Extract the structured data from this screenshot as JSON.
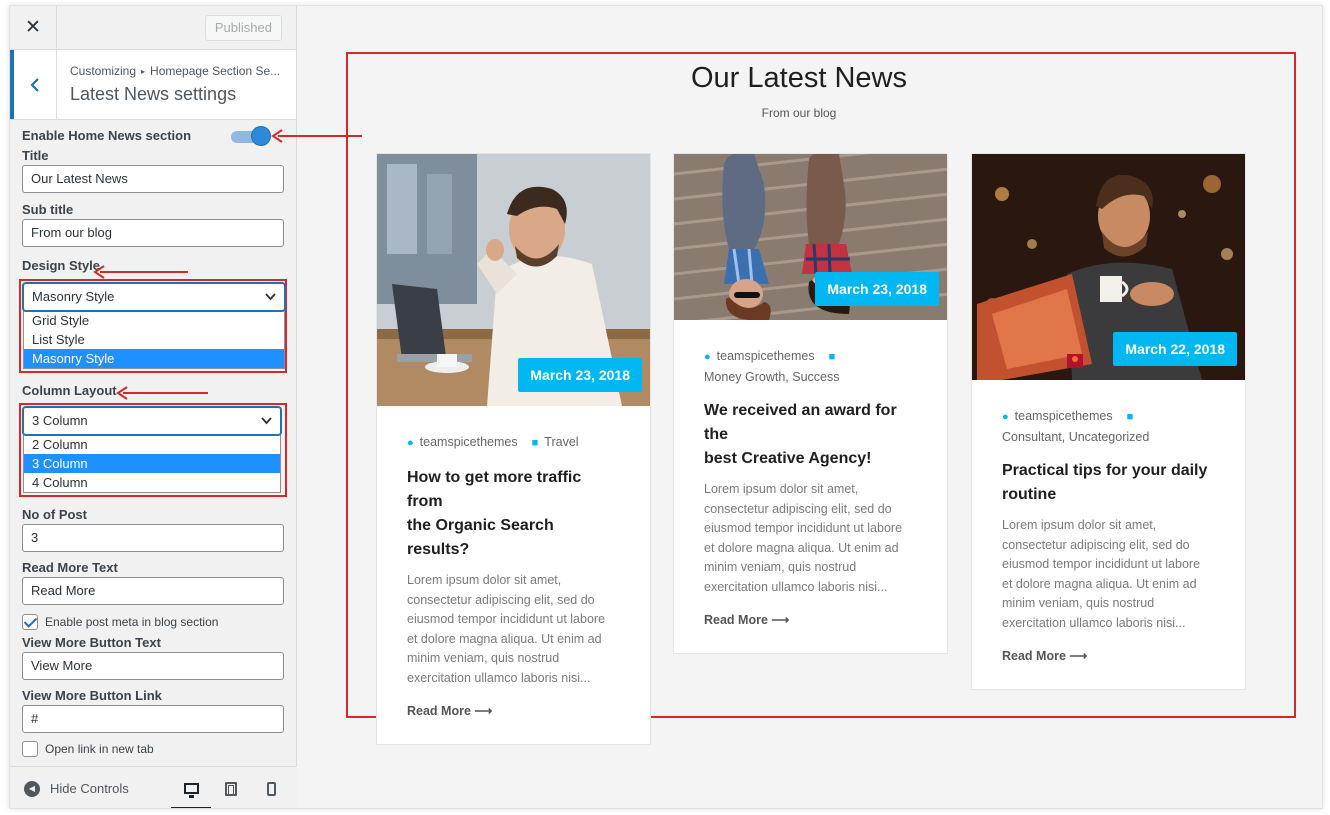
{
  "topbar": {
    "close_glyph": "✕",
    "published_label": "Published"
  },
  "section": {
    "breadcrumb_root": "Customizing",
    "breadcrumb_sep": "▸",
    "breadcrumb_parent": "Homepage Section Se...",
    "title": "Latest News settings"
  },
  "controls": {
    "enable_label": "Enable Home News section",
    "enable_on": true,
    "title_label": "Title",
    "title_value": "Our Latest News",
    "subtitle_label": "Sub title",
    "subtitle_value": "From our blog",
    "design_label": "Design Style",
    "design_selected": "Masonry Style",
    "design_options": [
      "Grid Style",
      "List Style",
      "Masonry Style"
    ],
    "column_label": "Column Layout",
    "column_selected": "3 Column",
    "column_options": [
      "2 Column",
      "3 Column",
      "4 Column"
    ],
    "posts_label": "No of Post",
    "posts_value": "3",
    "readmore_label": "Read More Text",
    "readmore_value": "Read More",
    "meta_check_label": "Enable post meta in blog section",
    "meta_checked": true,
    "viewmore_label": "View More Button Text",
    "viewmore_value": "View More",
    "viewlink_label": "View More Button Link",
    "viewlink_value": "#",
    "newtab_label": "Open link in new tab",
    "newtab_checked": false
  },
  "footer": {
    "hide_label": "Hide Controls",
    "hide_glyph": "◀"
  },
  "preview": {
    "heading": "Our Latest News",
    "subheading": "From our blog",
    "accent_color": "#00b7f1",
    "cards": [
      {
        "date": "March 23, 2018",
        "author": "teamspicethemes",
        "categories": "Travel",
        "title_line1": "How to get more traffic from",
        "title_line2": "the Organic Search results?",
        "excerpt": [
          "Lorem ipsum dolor sit amet,",
          "consectetur adipiscing elit, sed do",
          "eiusmod tempor incididunt ut labore",
          "et dolore magna aliqua. Ut enim ad",
          "minim veniam, quis nostrud",
          "exercitation ullamco laboris nisi..."
        ],
        "read_more": "Read More ⟶"
      },
      {
        "date": "March 23, 2018",
        "author": "teamspicethemes",
        "categories": "Money Growth, Success",
        "title_line1": "We received an award for the",
        "title_line2": "best Creative Agency!",
        "excerpt": [
          "Lorem ipsum dolor sit amet,",
          "consectetur adipiscing elit, sed do",
          "eiusmod tempor incididunt ut labore",
          "et dolore magna aliqua. Ut enim ad",
          "minim veniam, quis nostrud",
          "exercitation ullamco laboris nisi..."
        ],
        "read_more": "Read More ⟶"
      },
      {
        "date": "March 22, 2018",
        "author": "teamspicethemes",
        "categories": "Consultant, Uncategorized",
        "title_line1": "Practical tips for your daily",
        "title_line2": "routine",
        "excerpt": [
          "Lorem ipsum dolor sit amet,",
          "consectetur adipiscing elit, sed do",
          "eiusmod tempor incididunt ut labore",
          "et dolore magna aliqua. Ut enim ad",
          "minim veniam, quis nostrud",
          "exercitation ullamco laboris nisi..."
        ],
        "read_more": "Read More ⟶"
      }
    ]
  }
}
